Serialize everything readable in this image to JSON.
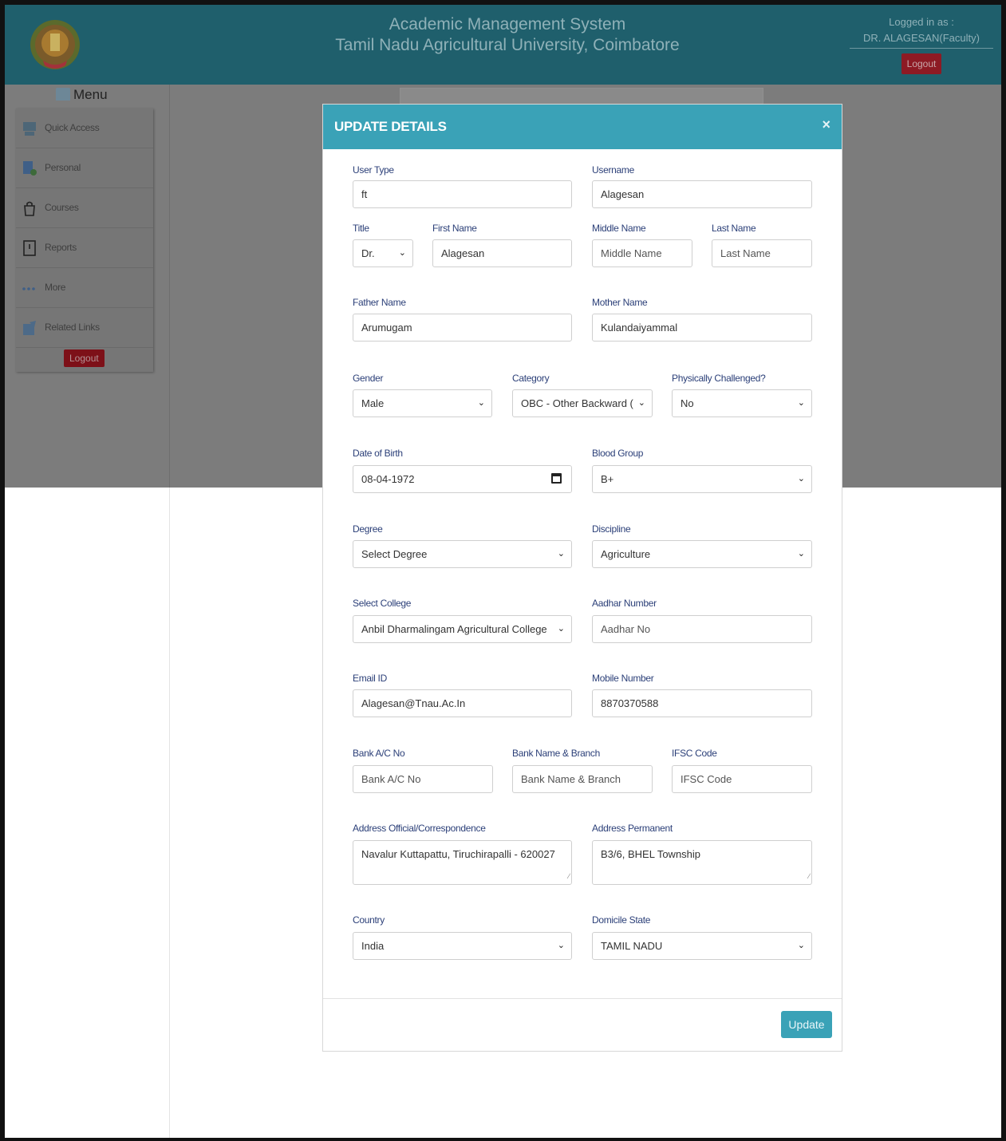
{
  "header": {
    "title_line1": "Academic Management System",
    "title_line2": "Tamil Nadu Agricultural University, Coimbatore",
    "logged_in_label": "Logged in as :",
    "user": "DR. ALAGESAN(Faculty)",
    "logout_label": "Logout"
  },
  "sidebar": {
    "title": "Menu",
    "items": [
      {
        "label": "Quick Access",
        "icon": "computer-icon"
      },
      {
        "label": "Personal",
        "icon": "user-book-icon"
      },
      {
        "label": "Courses",
        "icon": "bag-icon"
      },
      {
        "label": "Reports",
        "icon": "report-icon"
      },
      {
        "label": "More",
        "icon": "dots-icon"
      },
      {
        "label": "Related Links",
        "icon": "external-link-icon"
      }
    ],
    "logout_label": "Logout"
  },
  "modal": {
    "title": "UPDATE DETAILS",
    "close_symbol": "×",
    "fields": {
      "user_type": {
        "label": "User Type",
        "value": "ft"
      },
      "username": {
        "label": "Username",
        "value": "Alagesan"
      },
      "title": {
        "label": "Title",
        "value": "Dr."
      },
      "first_name": {
        "label": "First Name",
        "value": "Alagesan"
      },
      "middle_name": {
        "label": "Middle Name",
        "placeholder": "Middle Name"
      },
      "last_name": {
        "label": "Last Name",
        "placeholder": "Last Name"
      },
      "father_name": {
        "label": "Father Name",
        "value": "Arumugam"
      },
      "mother_name": {
        "label": "Mother Name",
        "value": "Kulandaiyammal"
      },
      "gender": {
        "label": "Gender",
        "value": "Male"
      },
      "category": {
        "label": "Category",
        "value": "OBC - Other Backward ("
      },
      "physically_challenged": {
        "label": "Physically Challenged?",
        "value": "No"
      },
      "dob": {
        "label": "Date of Birth",
        "value": "08-04-1972"
      },
      "blood_group": {
        "label": "Blood Group",
        "value": "B+"
      },
      "degree": {
        "label": "Degree",
        "value": "Select Degree"
      },
      "discipline": {
        "label": "Discipline",
        "value": "Agriculture"
      },
      "college": {
        "label": "Select College",
        "value": "Anbil Dharmalingam Agricultural College"
      },
      "aadhar": {
        "label": "Aadhar Number",
        "placeholder": "Aadhar No"
      },
      "email": {
        "label": "Email ID",
        "value": "Alagesan@Tnau.Ac.In"
      },
      "mobile": {
        "label": "Mobile Number",
        "value": "8870370588"
      },
      "bank_ac": {
        "label": "Bank A/C No",
        "placeholder": "Bank A/C No"
      },
      "bank_name": {
        "label": "Bank Name & Branch",
        "placeholder": "Bank Name & Branch"
      },
      "ifsc": {
        "label": "IFSC Code",
        "placeholder": "IFSC Code"
      },
      "addr_official": {
        "label": "Address Official/Correspondence",
        "value": "Navalur Kuttapattu, Tiruchirapalli - 620027"
      },
      "addr_permanent": {
        "label": "Address Permanent",
        "value": "B3/6, BHEL Township"
      },
      "country": {
        "label": "Country",
        "value": "India"
      },
      "domicile": {
        "label": "Domicile State",
        "value": "TAMIL NADU"
      }
    },
    "update_label": "Update"
  },
  "colors": {
    "header_bg": "#1f5f6c",
    "modal_header": "#3aa2b7",
    "label_text": "#2b3f78",
    "logout_red": "#8d1a24"
  }
}
